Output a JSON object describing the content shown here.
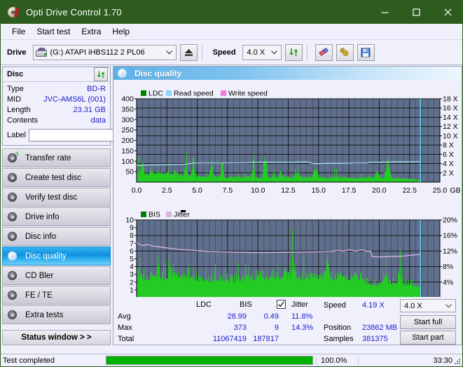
{
  "window": {
    "title": "Opti Drive Control 1.70",
    "icon": "disc-icon",
    "minimize": "−",
    "maximize": "□",
    "close": "✕"
  },
  "menu": {
    "items": [
      {
        "label": "File",
        "name": "menu-file"
      },
      {
        "label": "Start test",
        "name": "menu-start-test"
      },
      {
        "label": "Extra",
        "name": "menu-extra"
      },
      {
        "label": "Help",
        "name": "menu-help"
      }
    ]
  },
  "toolbar": {
    "drive_label": "Drive",
    "drive_value": "(G:)  ATAPI iHBS112  2 PL06",
    "eject_icon": "eject-icon",
    "speed_label": "Speed",
    "speed_value": "4.0 X",
    "refresh_icon": "refresh-icon",
    "erase_icon": "eraser-icon",
    "tools_icon": "wrench-icon",
    "save_icon": "save-icon"
  },
  "disc_panel": {
    "title": "Disc",
    "refresh_icon": "refresh-icon",
    "rows": [
      {
        "key": "Type",
        "value": "BD-R"
      },
      {
        "key": "MID",
        "value": "JVC-AMS6L (001)"
      },
      {
        "key": "Length",
        "value": "23.31 GB"
      },
      {
        "key": "Contents",
        "value": "data"
      }
    ],
    "label_key": "Label",
    "label_value": "",
    "label_placeholder": "",
    "disc_icon": "cd-icon"
  },
  "nav": {
    "items": [
      {
        "label": "Transfer rate",
        "name": "sidebar-item-transfer-rate",
        "active": false
      },
      {
        "label": "Create test disc",
        "name": "sidebar-item-create-test-disc",
        "active": false
      },
      {
        "label": "Verify test disc",
        "name": "sidebar-item-verify-test-disc",
        "active": false
      },
      {
        "label": "Drive info",
        "name": "sidebar-item-drive-info",
        "active": false
      },
      {
        "label": "Disc info",
        "name": "sidebar-item-disc-info",
        "active": false
      },
      {
        "label": "Disc quality",
        "name": "sidebar-item-disc-quality",
        "active": true
      },
      {
        "label": "CD Bler",
        "name": "sidebar-item-cd-bler",
        "active": false
      },
      {
        "label": "FE / TE",
        "name": "sidebar-item-fe-te",
        "active": false
      },
      {
        "label": "Extra tests",
        "name": "sidebar-item-extra-tests",
        "active": false
      }
    ],
    "status_window": "Status window > >"
  },
  "content": {
    "title": "Disc quality",
    "title_icon": "disc-quality-icon"
  },
  "stats": {
    "col_ldc": "LDC",
    "col_bis": "BIS",
    "jitter_label": "Jitter",
    "jitter_checked": true,
    "row_avg": "Avg",
    "row_max": "Max",
    "row_total": "Total",
    "avg_ldc": "28.99",
    "avg_bis": "0.49",
    "avg_jitter": "11.8%",
    "max_ldc": "373",
    "max_bis": "9",
    "max_jitter": "14.3%",
    "total_ldc": "11067419",
    "total_bis": "187817",
    "speed_label": "Speed",
    "speed_value": "4.19 X",
    "position_label": "Position",
    "position_value": "23862 MB",
    "samples_label": "Samples",
    "samples_value": "381375",
    "speed_select": "4.0 X",
    "start_full": "Start full",
    "start_part": "Start part"
  },
  "statusbar": {
    "message": "Test completed",
    "progress_percent": 100,
    "progress_text": "100.0%",
    "elapsed": "33:30"
  },
  "colors": {
    "titlebar": "#2d5c1e",
    "accent_blue": "#1c1ccc",
    "plot_bg": "#5f6f8c",
    "ldc_green": "#22cc22",
    "bis_green": "#22cc22",
    "read_speed": "#8ad4f5",
    "write_speed": "#f07ae0",
    "jitter": "#d9b3dd",
    "progress_green": "#00b200"
  },
  "chart_data": [
    {
      "type": "area",
      "name": "ldc-chart",
      "title": "LDC / Read speed",
      "legend": [
        {
          "label": "LDC",
          "color": "#008000"
        },
        {
          "label": "Read speed",
          "color": "#8ad4f5"
        },
        {
          "label": "Write speed",
          "color": "#f07ae0"
        }
      ],
      "legend_position": "top-left",
      "xlabel": "GB",
      "xlim": [
        0,
        25.0
      ],
      "xticks": [
        "0.0",
        "2.5",
        "5.0",
        "7.5",
        "10.0",
        "12.5",
        "15.0",
        "17.5",
        "20.0",
        "22.5",
        "25.0"
      ],
      "ylabel_left": "LDC",
      "ylim": [
        0,
        400
      ],
      "yticks": [
        50,
        100,
        150,
        200,
        250,
        300,
        350,
        400
      ],
      "ylabel_right": "Speed",
      "ylim_right": [
        0,
        18
      ],
      "yticks_right": [
        "2 X",
        "4 X",
        "6 X",
        "8 X",
        "10 X",
        "12 X",
        "14 X",
        "16 X",
        "18 X"
      ],
      "grid": true,
      "data_end_gb": 23.4,
      "series": [
        {
          "name": "LDC",
          "color": "#22cc22",
          "kind": "area",
          "x": [
            0.0,
            0.15,
            0.3,
            0.45,
            0.6,
            0.75,
            0.9,
            1.05,
            1.2,
            1.35,
            1.5,
            1.65,
            1.8,
            1.95,
            2.1,
            2.25,
            2.4,
            2.55,
            2.7,
            2.85,
            3.0,
            3.15,
            3.3,
            3.45,
            3.6,
            3.75,
            3.9,
            4.05,
            4.2,
            4.35,
            4.5,
            4.65,
            4.8,
            4.95,
            5.1,
            5.25,
            5.4,
            5.55,
            5.7,
            5.85,
            6.0,
            6.15,
            6.3,
            6.45,
            6.6,
            6.75,
            6.9,
            7.05,
            7.2,
            7.35,
            7.5,
            7.65,
            7.8,
            7.95,
            8.1,
            8.25,
            8.4,
            8.55,
            8.7,
            8.85,
            9.0,
            9.15,
            9.3,
            9.45,
            9.6,
            9.75,
            9.9,
            10.05,
            10.2,
            10.35,
            10.5,
            10.65,
            10.8,
            10.95,
            11.1,
            11.25,
            11.4,
            11.55,
            11.7,
            11.85,
            12.0,
            12.3,
            12.6,
            12.9,
            13.2,
            13.5,
            13.8,
            14.1,
            14.4,
            14.7,
            15.0,
            15.3,
            15.6,
            15.9,
            16.2,
            16.5,
            16.8,
            17.1,
            17.4,
            17.7,
            18.0,
            18.3,
            18.6,
            18.9,
            19.2,
            19.5,
            19.8,
            20.1,
            20.4,
            20.7,
            21.0,
            21.3,
            21.6,
            21.9,
            22.2,
            22.5,
            22.8,
            23.1,
            23.4
          ],
          "y": [
            88,
            72,
            65,
            178,
            70,
            62,
            60,
            58,
            96,
            64,
            60,
            58,
            92,
            70,
            66,
            62,
            58,
            82,
            60,
            58,
            56,
            86,
            62,
            58,
            54,
            52,
            50,
            176,
            52,
            50,
            48,
            190,
            50,
            46,
            44,
            42,
            44,
            46,
            40,
            44,
            42,
            160,
            44,
            40,
            38,
            42,
            40,
            172,
            40,
            38,
            36,
            40,
            42,
            38,
            40,
            36,
            38,
            40,
            36,
            38,
            36,
            40,
            38,
            36,
            150,
            38,
            36,
            34,
            38,
            36,
            170,
            175,
            38,
            36,
            34,
            60,
            38,
            36,
            34,
            95,
            40,
            38,
            36,
            34,
            85,
            38,
            36,
            34,
            32,
            120,
            36,
            34,
            32,
            30,
            36,
            34,
            32,
            30,
            34,
            32,
            30,
            28,
            36,
            34,
            32,
            30,
            95,
            34,
            32,
            165,
            30,
            28,
            32,
            30,
            26,
            24,
            22,
            20,
            18
          ]
        },
        {
          "name": "Read speed",
          "color": "#a8e0f8",
          "kind": "line",
          "x": [
            0.0,
            1.0,
            2.0,
            3.0,
            4.0,
            4.7,
            5.0,
            6.0,
            7.0,
            8.0,
            9.0,
            9.6,
            10.0,
            11.0,
            12.0,
            13.0,
            14.0,
            14.6,
            15.0,
            16.0,
            17.0,
            18.0,
            19.0,
            19.3,
            20.0,
            21.0,
            22.0,
            22.8,
            23.4
          ],
          "y": [
            3.6,
            3.7,
            3.75,
            3.8,
            3.85,
            4.1,
            4.1,
            4.1,
            4.1,
            4.15,
            4.15,
            4.3,
            4.3,
            4.3,
            4.3,
            4.3,
            4.35,
            4.0,
            4.0,
            4.05,
            4.05,
            4.1,
            4.1,
            4.3,
            4.3,
            4.35,
            4.35,
            4.4,
            4.4
          ]
        }
      ],
      "cursor_gb": 23.4
    },
    {
      "type": "area",
      "name": "bis-chart",
      "title": "BIS / Jitter",
      "legend": [
        {
          "label": "BIS",
          "color": "#008000"
        },
        {
          "label": "Jitter",
          "color": "#d9b3dd"
        }
      ],
      "legend_position": "top-left",
      "xlabel": "GB",
      "xlim": [
        0,
        25.0
      ],
      "xticks": [
        "0.0",
        "2.5",
        "5.0",
        "7.5",
        "10.0",
        "12.5",
        "15.0",
        "17.5",
        "20.0",
        "22.5",
        "25.0"
      ],
      "ylabel_left": "BIS",
      "ylim": [
        0,
        10
      ],
      "yticks": [
        1,
        2,
        3,
        4,
        5,
        6,
        7,
        8,
        9,
        10
      ],
      "ylabel_right": "Jitter",
      "ylim_right": [
        0,
        20
      ],
      "yticks_right": [
        "4%",
        "8%",
        "12%",
        "16%",
        "20%"
      ],
      "grid": true,
      "data_end_gb": 23.4,
      "series": [
        {
          "name": "BIS",
          "color": "#22cc22",
          "kind": "area",
          "x": [
            0.0,
            0.2,
            0.4,
            0.6,
            0.8,
            1.0,
            1.2,
            1.4,
            1.6,
            1.8,
            2.0,
            2.2,
            2.4,
            2.6,
            2.8,
            3.0,
            3.2,
            3.4,
            3.6,
            3.8,
            4.0,
            4.2,
            4.4,
            4.6,
            4.8,
            5.0,
            5.2,
            5.4,
            5.6,
            5.8,
            6.0,
            6.2,
            6.4,
            6.6,
            6.8,
            7.0,
            7.2,
            7.4,
            7.6,
            7.8,
            8.0,
            8.2,
            8.4,
            8.6,
            8.8,
            9.0,
            9.2,
            9.4,
            9.6,
            9.8,
            10.0,
            10.3,
            10.6,
            10.9,
            11.2,
            11.5,
            11.8,
            12.1,
            12.4,
            12.7,
            13.0,
            13.3,
            13.6,
            13.9,
            14.2,
            14.5,
            14.8,
            15.1,
            15.4,
            15.7,
            16.0,
            16.3,
            16.6,
            16.9,
            17.2,
            17.5,
            17.8,
            18.1,
            18.4,
            18.7,
            19.0,
            19.3,
            19.6,
            19.9,
            20.2,
            20.5,
            20.8,
            21.1,
            21.4,
            21.7,
            22.0,
            22.3,
            22.6,
            22.9,
            23.2,
            23.4
          ],
          "y": [
            5.0,
            4.6,
            4.3,
            4.2,
            4.1,
            4.0,
            4.8,
            5.6,
            4.4,
            5.9,
            4.2,
            4.0,
            4.1,
            4.3,
            6.4,
            5.2,
            4.5,
            4.3,
            4.6,
            4.2,
            4.3,
            4.1,
            4.0,
            4.2,
            4.1,
            4.0,
            3.6,
            4.0,
            3.8,
            4.0,
            3.5,
            3.9,
            4.0,
            3.2,
            3.9,
            4.0,
            3.8,
            4.0,
            3.6,
            3.9,
            3.4,
            4.0,
            3.8,
            4.0,
            3.7,
            4.2,
            5.0,
            4.1,
            4.0,
            4.3,
            4.1,
            4.9,
            4.2,
            4.0,
            5.1,
            4.2,
            4.0,
            5.0,
            4.3,
            4.1,
            5.6,
            4.2,
            4.0,
            4.5,
            4.1,
            4.3,
            4.0,
            4.4,
            4.1,
            6.8,
            4.2,
            4.0,
            4.5,
            4.1,
            4.3,
            4.0,
            4.6,
            4.2,
            4.0,
            4.3,
            3.2,
            2.9,
            3.1,
            2.6,
            3.0,
            5.5,
            2.8,
            3.2,
            2.7,
            5.6,
            3.0,
            2.8,
            3.1,
            2.6,
            2.4,
            2.2
          ]
        },
        {
          "name": "Jitter",
          "color": "#d9b3dd",
          "kind": "line",
          "x": [
            0.0,
            0.3,
            0.6,
            0.9,
            1.2,
            1.5,
            2.0,
            2.5,
            3.0,
            3.5,
            4.0,
            4.5,
            5.0,
            5.5,
            6.0,
            6.5,
            7.0,
            7.5,
            8.0,
            8.5,
            9.0,
            9.5,
            10.0,
            11.0,
            12.0,
            13.0,
            14.0,
            15.0,
            16.0,
            16.6,
            17.0,
            17.6,
            18.0,
            18.6,
            19.0,
            19.3,
            19.4,
            20.0,
            20.5,
            21.0,
            21.5,
            22.0,
            22.5,
            23.0,
            23.4
          ],
          "y": [
            14.2,
            13.6,
            13.4,
            13.7,
            13.4,
            13.2,
            13.0,
            12.8,
            12.6,
            12.4,
            12.3,
            12.2,
            12.1,
            12.0,
            11.9,
            11.85,
            11.8,
            11.75,
            11.7,
            11.7,
            11.65,
            11.6,
            11.6,
            11.6,
            11.65,
            11.7,
            11.75,
            11.8,
            11.9,
            12.2,
            12.0,
            12.3,
            12.0,
            12.3,
            11.9,
            12.0,
            10.6,
            10.5,
            10.5,
            10.6,
            10.6,
            10.7,
            10.9,
            11.0,
            11.1
          ]
        }
      ],
      "cursor_gb": 23.4
    }
  ]
}
